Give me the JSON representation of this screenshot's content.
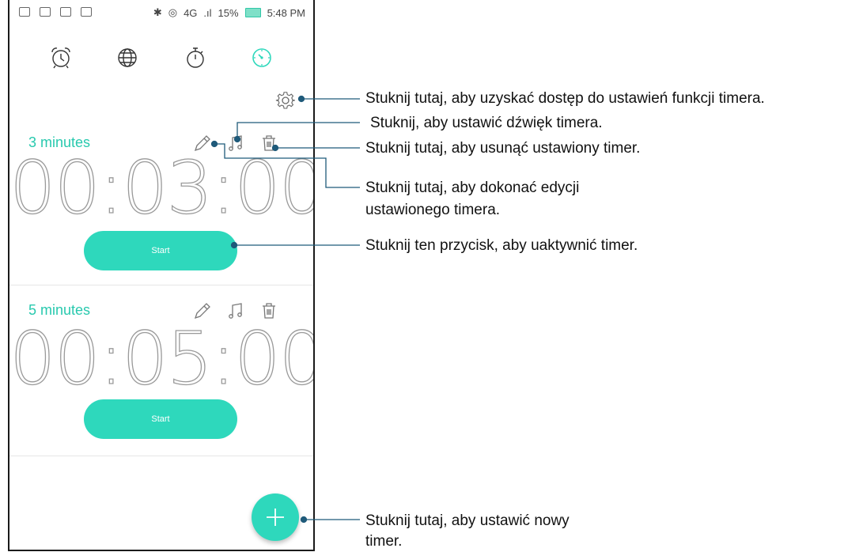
{
  "status_bar": {
    "network": "4G",
    "battery": "15%",
    "time": "5:48 PM"
  },
  "tabs": [
    {
      "name": "alarm-clock-icon",
      "active": false
    },
    {
      "name": "world-clock-icon",
      "active": false
    },
    {
      "name": "stopwatch-icon",
      "active": false
    },
    {
      "name": "timer-icon",
      "active": true
    }
  ],
  "timers": [
    {
      "label": "3 minutes",
      "time": "00:03:00",
      "start_label": "Start"
    },
    {
      "label": "5 minutes",
      "time": "00:05:00",
      "start_label": "Start"
    }
  ],
  "annotations": {
    "settings": "Stuknij tutaj, aby uzyskać dostęp do ustawień funkcji timera.",
    "sound": "Stuknij, aby ustawić dźwięk timera.",
    "delete": "Stuknij tutaj, aby usunąć ustawiony timer.",
    "edit_line1": "Stuknij tutaj, aby dokonać edycji",
    "edit_line2": "ustawionego timera.",
    "start": "Stuknij ten przycisk, aby uaktywnić timer.",
    "add_line1": "Stuknij tutaj, aby ustawić nowy",
    "add_line2": "timer."
  },
  "colors": {
    "accent": "#2ed8bc",
    "accent_text": "#28c9ae",
    "border": "#1a1a1a"
  }
}
